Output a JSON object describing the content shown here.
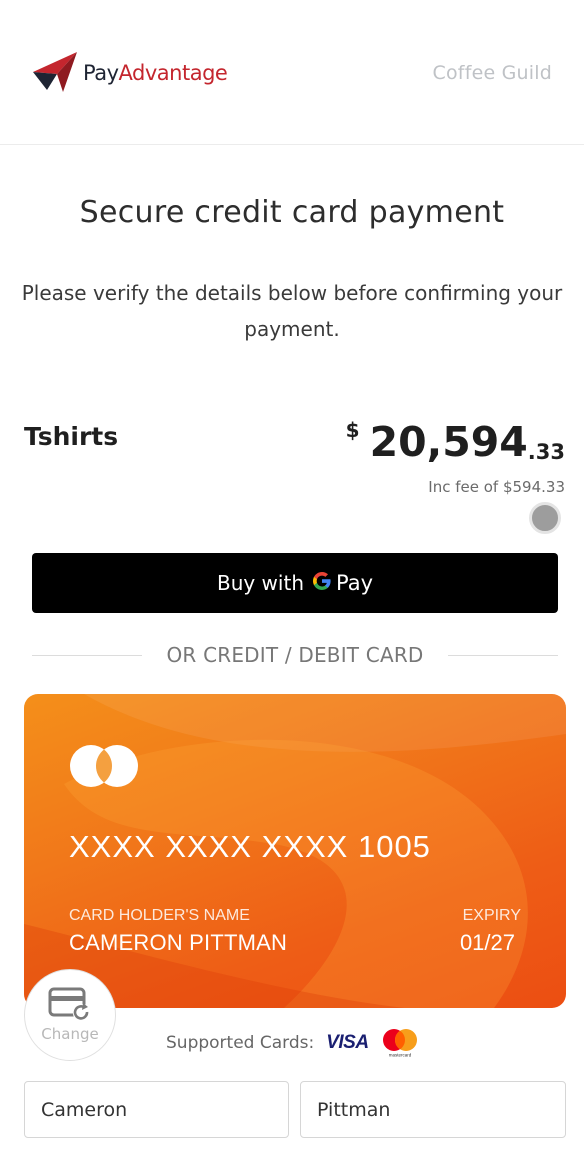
{
  "header": {
    "brand_part1": "Pay",
    "brand_part2": "Advantage",
    "merchant_name": "Coffee Guild"
  },
  "page": {
    "title": "Secure credit card payment",
    "subtitle": "Please verify the details below before confirming your payment."
  },
  "order": {
    "product": "Tshirts",
    "currency_symbol": "$",
    "amount_whole": "20,594",
    "amount_cents": ".33",
    "fee_note": "Inc fee of $594.33"
  },
  "gpay": {
    "label": "Buy with",
    "pay_word": "Pay"
  },
  "divider": {
    "text": "OR CREDIT / DEBIT CARD"
  },
  "card": {
    "number": "XXXX XXXX XXXX 1005",
    "holder_label": "CARD HOLDER'S NAME",
    "holder_name": "CAMERON PITTMAN",
    "expiry_label": "EXPIRY",
    "expiry_value": "01/27",
    "brand_icon": "mastercard-outline-icon"
  },
  "change_button": {
    "label": "Change",
    "icon": "card-refresh-icon"
  },
  "supported": {
    "label": "Supported Cards:",
    "visa": "VISA",
    "mastercard_text": "mastercard"
  },
  "form": {
    "first_name": "Cameron",
    "last_name": "Pittman"
  },
  "colors": {
    "brand_red": "#c4262e",
    "card_orange": "#f1781a",
    "gpay_black": "#000000"
  }
}
